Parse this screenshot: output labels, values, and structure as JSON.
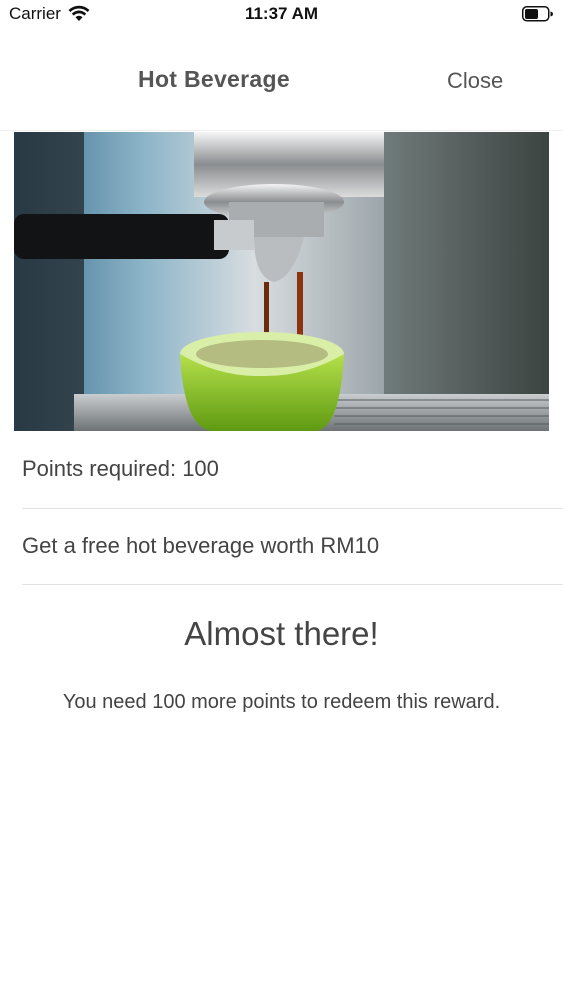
{
  "status_bar": {
    "carrier": "Carrier",
    "time": "11:37 AM",
    "icons": [
      "wifi-icon",
      "battery-icon"
    ]
  },
  "header": {
    "title": "Hot Beverage",
    "close_label": "Close"
  },
  "hero_image": {
    "description_icon": "espresso-machine-photo"
  },
  "reward": {
    "points_required": "Points required: 100",
    "description": "Get a free hot beverage worth RM10"
  },
  "redeem_status": {
    "heading": "Almost there!",
    "message": "You need 100 more points to redeem this reward."
  },
  "colors": {
    "text": "#444444",
    "divider": "#e2e2e2",
    "cup_green": "#8cc63f"
  }
}
